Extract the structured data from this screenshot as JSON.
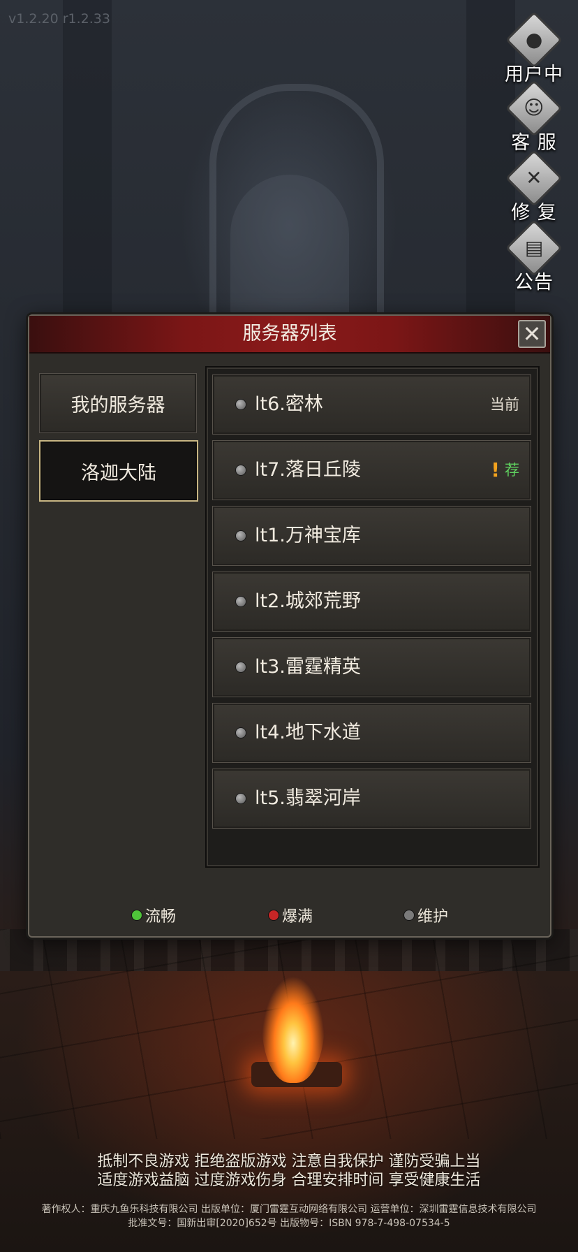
{
  "version": "v1.2.20 r1.2.33",
  "side_menu": [
    {
      "label": "用户中心",
      "icon": "user-icon"
    },
    {
      "label": "客 服",
      "icon": "customer-service-icon"
    },
    {
      "label": "修 复",
      "icon": "wrench-icon"
    },
    {
      "label": "公告",
      "icon": "notice-board-icon"
    }
  ],
  "panel": {
    "title": "服务器列表",
    "close_icon": "close-icon",
    "regions": [
      {
        "label": "我的服务器",
        "active": false
      },
      {
        "label": "洛迦大陆",
        "active": true
      }
    ],
    "servers": [
      {
        "name": "lt6.密林",
        "status": "maintenance",
        "tag": "当前"
      },
      {
        "name": "lt7.落日丘陵",
        "status": "maintenance",
        "warn": "!",
        "rec": "荐"
      },
      {
        "name": "lt1.万神宝库",
        "status": "maintenance"
      },
      {
        "name": "lt2.城郊荒野",
        "status": "maintenance"
      },
      {
        "name": "lt3.雷霆精英",
        "status": "maintenance"
      },
      {
        "name": "lt4.地下水道",
        "status": "maintenance"
      },
      {
        "name": "lt5.翡翠河岸",
        "status": "maintenance"
      }
    ],
    "legend": [
      {
        "label": "流畅",
        "color": "#4fc43a"
      },
      {
        "label": "爆满",
        "color": "#c62626"
      },
      {
        "label": "维护",
        "color": "#7a7a7a"
      }
    ]
  },
  "notice": {
    "line1": "抵制不良游戏 拒绝盗版游戏 注意自我保护 谨防受骗上当",
    "line2": "适度游戏益脑 过度游戏伤身 合理安排时间 享受健康生活"
  },
  "copyright": {
    "line1": "著作权人：重庆九鱼乐科技有限公司 出版单位：厦门雷霆互动网络有限公司 运营单位：深圳雷霆信息技术有限公司",
    "line2": "批准文号：国新出审[2020]652号 出版物号：ISBN 978-7-498-07534-5"
  }
}
